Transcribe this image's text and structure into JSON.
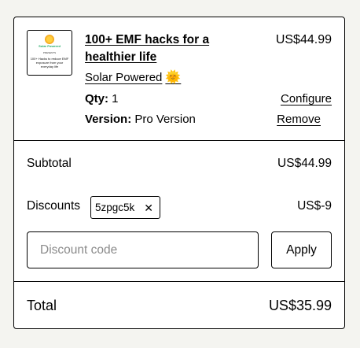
{
  "product": {
    "title": "100+ EMF hacks for a healthier life",
    "price": "US$44.99",
    "seller": "Solar Powered",
    "seller_emoji": "🌞",
    "qty_label": "Qty:",
    "qty_value": "1",
    "version_label": "Version:",
    "version_value": "Pro Version",
    "configure_label": "Configure",
    "remove_label": "Remove",
    "thumbnail": {
      "logo_text": "Solar Powered",
      "line1": "PRESENTS",
      "line2": "100+ Hacks to reduce EMF exposure from your everyday life"
    }
  },
  "summary": {
    "subtotal_label": "Subtotal",
    "subtotal_value": "US$44.99",
    "discounts_label": "Discounts",
    "discount_code_chip": "5zpgc5k",
    "discount_value": "US$-9",
    "discount_input_placeholder": "Discount code",
    "apply_label": "Apply",
    "total_label": "Total",
    "total_value": "US$35.99"
  }
}
